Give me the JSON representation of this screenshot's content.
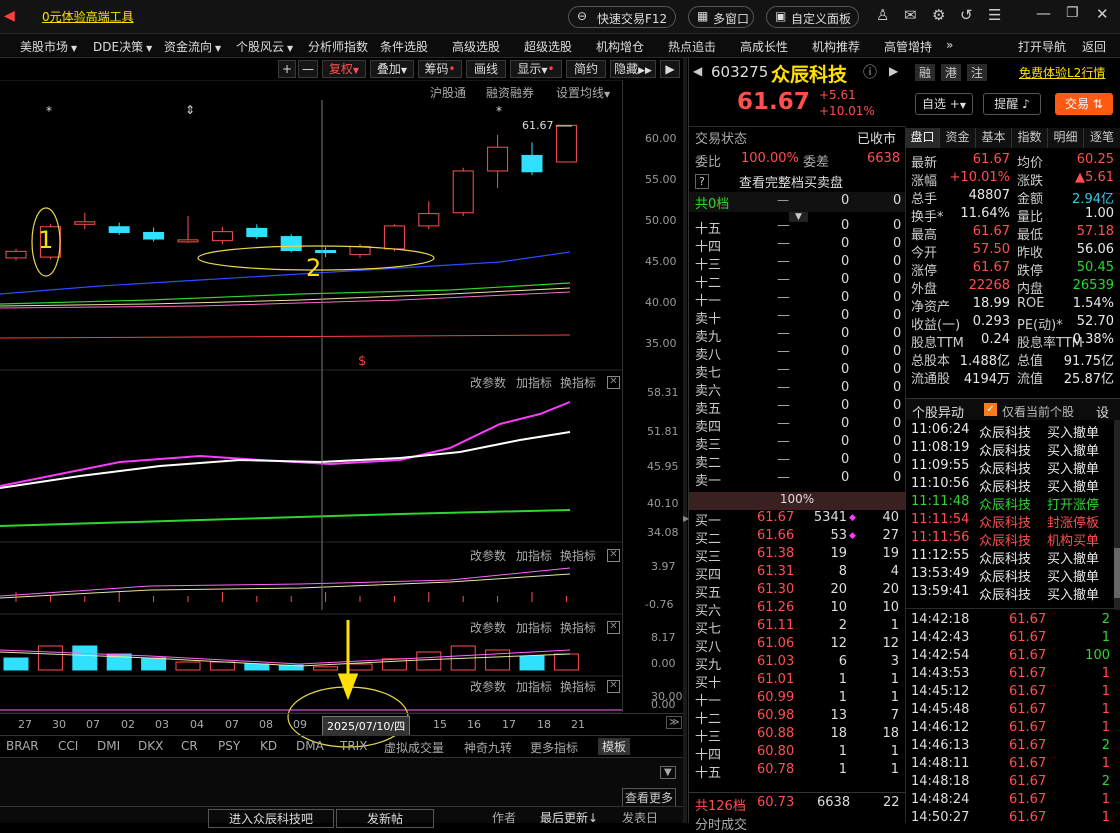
{
  "topbar": {
    "promo": "0元体验高端工具",
    "quick_trade": "快速交易F12",
    "multi_window": "多窗口",
    "custom_panel": "自定义面板"
  },
  "menu": [
    "美股市场",
    "DDE决策",
    "资金流向",
    "个股风云",
    "分析师指数",
    "条件选股",
    "高级选股",
    "超级选股",
    "机构增仓",
    "热点追击",
    "高成长性",
    "机构推荐",
    "高管增持"
  ],
  "menu_more": "»",
  "menu_right": {
    "open_nav": "打开导航",
    "back": "返回"
  },
  "chart_toolbar": {
    "plus": "+",
    "minus": "—",
    "fuquan": "复权",
    "overlay": "叠加",
    "chouma": "筹码",
    "draw": "画线",
    "display": "显示",
    "simple": "简约",
    "hide": "隐藏"
  },
  "chart_subbar": {
    "hgt": "沪股通",
    "rzrq": "融资融券",
    "set_ma": "设置均线"
  },
  "price_axis": [
    "60.00",
    "55.00",
    "50.00",
    "45.00",
    "40.00",
    "35.00"
  ],
  "last_price_label": "61.67",
  "annotations": {
    "a1": "1",
    "a2": "2",
    "s_mark": "$",
    "star": "*"
  },
  "panel_btns": {
    "params": "改参数",
    "add_ind": "加指标",
    "switch_ind": "换指标",
    "close": "✕"
  },
  "ind1_axis": [
    "58.31",
    "51.81",
    "45.95",
    "40.10",
    "34.08"
  ],
  "ind2_axis": [
    "3.97",
    "-0.76"
  ],
  "ind3_axis": [
    "8.17",
    "0.00"
  ],
  "ind4_axis": [
    "30.00",
    "0.00"
  ],
  "dates": [
    "27",
    "30",
    "07",
    "02",
    "03",
    "04",
    "07",
    "08",
    "09",
    "2025/07/10/四",
    "15",
    "16",
    "17",
    "18",
    "21"
  ],
  "ind_tabs": [
    "BRAR",
    "CCI",
    "DMI",
    "DKX",
    "CR",
    "PSY",
    "KD",
    "DMA",
    "TRIX",
    "虚拟成交量",
    "神奇九转",
    "更多指标",
    "模板"
  ],
  "bottom": {
    "see_more": "查看更多",
    "forum": "进入众辰科技吧",
    "post": "发新帖",
    "author": "作者",
    "last_update": "最后更新",
    "post_time": "发表日"
  },
  "stock": {
    "code": "603275",
    "name": "众辰科技",
    "price": "61.67",
    "change": "+5.61",
    "change_pct": "+10.01%",
    "tags": [
      "融",
      "港",
      "注"
    ],
    "l2": "免费体验L2行情",
    "zixuan": "自选",
    "remind": "提醒",
    "trade": "交易"
  },
  "status": {
    "label": "交易状态",
    "value": "已收市",
    "weibi_label": "委比",
    "weibi": "100.00%",
    "weicha_label": "委差",
    "weicha": "6638",
    "help": "?",
    "full_book": "查看完整档买卖盘",
    "total_label": "共0档",
    "dash": "—",
    "zero": "0"
  },
  "sell_rows": [
    {
      "l": "十五"
    },
    {
      "l": "十四"
    },
    {
      "l": "十三"
    },
    {
      "l": "十二"
    },
    {
      "l": "十一"
    },
    {
      "l": "卖十"
    },
    {
      "l": "卖九"
    },
    {
      "l": "卖八"
    },
    {
      "l": "卖七"
    },
    {
      "l": "卖六"
    },
    {
      "l": "卖五"
    },
    {
      "l": "卖四"
    },
    {
      "l": "卖三"
    },
    {
      "l": "卖二"
    },
    {
      "l": "卖一"
    }
  ],
  "mid_pct": "100%",
  "buy_rows": [
    {
      "l": "买一",
      "p": "61.67",
      "v": "5341",
      "d": "◆",
      "n": "40"
    },
    {
      "l": "买二",
      "p": "61.66",
      "v": "53",
      "d": "◆",
      "n": "27"
    },
    {
      "l": "买三",
      "p": "61.38",
      "v": "19",
      "d": "",
      "n": "19"
    },
    {
      "l": "买四",
      "p": "61.31",
      "v": "8",
      "d": "",
      "n": "4"
    },
    {
      "l": "买五",
      "p": "61.30",
      "v": "20",
      "d": "",
      "n": "20"
    },
    {
      "l": "买六",
      "p": "61.26",
      "v": "10",
      "d": "",
      "n": "10"
    },
    {
      "l": "买七",
      "p": "61.11",
      "v": "2",
      "d": "",
      "n": "1"
    },
    {
      "l": "买八",
      "p": "61.06",
      "v": "12",
      "d": "",
      "n": "12"
    },
    {
      "l": "买九",
      "p": "61.03",
      "v": "6",
      "d": "",
      "n": "3"
    },
    {
      "l": "买十",
      "p": "61.01",
      "v": "1",
      "d": "",
      "n": "1"
    },
    {
      "l": "十一",
      "p": "60.99",
      "v": "1",
      "d": "",
      "n": "1"
    },
    {
      "l": "十二",
      "p": "60.98",
      "v": "13",
      "d": "",
      "n": "7"
    },
    {
      "l": "十三",
      "p": "60.88",
      "v": "18",
      "d": "",
      "n": "18"
    },
    {
      "l": "十四",
      "p": "60.80",
      "v": "1",
      "d": "",
      "n": "1"
    },
    {
      "l": "十五",
      "p": "60.78",
      "v": "1",
      "d": "",
      "n": "1"
    }
  ],
  "buy_total": {
    "l": "共126档",
    "p": "60.73",
    "v": "6638",
    "n": "22"
  },
  "time_trade": "分时成交",
  "quote_tabs": [
    "盘口",
    "资金",
    "基本",
    "指数",
    "明细",
    "逐笔"
  ],
  "quote": [
    {
      "k1": "最新",
      "v1": "61.67",
      "c1": "red",
      "k2": "均价",
      "v2": "60.25",
      "c2": "red"
    },
    {
      "k1": "涨幅",
      "v1": "+10.01%",
      "c1": "red",
      "k2": "涨跌",
      "v2": "▲5.61",
      "c2": "red"
    },
    {
      "k1": "总手",
      "v1": "48807",
      "c1": "white",
      "k2": "金额",
      "v2": "2.94亿",
      "c2": "cyan"
    },
    {
      "k1": "换手*",
      "v1": "11.64%",
      "c1": "white",
      "k2": "量比",
      "v2": "1.00",
      "c2": "white"
    },
    {
      "k1": "最高",
      "v1": "61.67",
      "c1": "red",
      "k2": "最低",
      "v2": "57.18",
      "c2": "red"
    },
    {
      "k1": "今开",
      "v1": "57.50",
      "c1": "red",
      "k2": "昨收",
      "v2": "56.06",
      "c2": "white"
    },
    {
      "k1": "涨停",
      "v1": "61.67",
      "c1": "red",
      "k2": "跌停",
      "v2": "50.45",
      "c2": "green"
    },
    {
      "k1": "外盘",
      "v1": "22268",
      "c1": "red",
      "k2": "内盘",
      "v2": "26539",
      "c2": "green"
    },
    {
      "k1": "净资产",
      "v1": "18.99",
      "c1": "white",
      "k2": "ROE",
      "v2": "1.54%",
      "c2": "white"
    },
    {
      "k1": "收益(一)",
      "v1": "0.293",
      "c1": "white",
      "k2": "PE(动)*",
      "v2": "52.70",
      "c2": "white"
    },
    {
      "k1": "股息TTM",
      "v1": "0.24",
      "c1": "white",
      "k2": "股息率TTM",
      "v2": "0.38%",
      "c2": "white"
    },
    {
      "k1": "总股本",
      "v1": "1.488亿",
      "c1": "white",
      "k2": "总值",
      "v2": "91.75亿",
      "c2": "white"
    },
    {
      "k1": "流通股",
      "v1": "4194万",
      "c1": "white",
      "k2": "流值",
      "v2": "25.87亿",
      "c2": "white"
    }
  ],
  "anomaly": {
    "title": "个股异动",
    "only_current": "仅看当前个股",
    "settings": "设",
    "rows": [
      {
        "t": "11:06:24",
        "n": "众辰科技",
        "a": "买入撤单",
        "c": "white"
      },
      {
        "t": "11:08:19",
        "n": "众辰科技",
        "a": "买入撤单",
        "c": "white"
      },
      {
        "t": "11:09:55",
        "n": "众辰科技",
        "a": "买入撤单",
        "c": "white"
      },
      {
        "t": "11:10:56",
        "n": "众辰科技",
        "a": "买入撤单",
        "c": "white"
      },
      {
        "t": "11:11:48",
        "n": "众辰科技",
        "a": "打开涨停",
        "c": "green"
      },
      {
        "t": "11:11:54",
        "n": "众辰科技",
        "a": "封涨停板",
        "c": "red"
      },
      {
        "t": "11:11:56",
        "n": "众辰科技",
        "a": "机构买单",
        "c": "red"
      },
      {
        "t": "11:12:55",
        "n": "众辰科技",
        "a": "买入撤单",
        "c": "white"
      },
      {
        "t": "13:53:49",
        "n": "众辰科技",
        "a": "买入撤单",
        "c": "white"
      },
      {
        "t": "13:59:41",
        "n": "众辰科技",
        "a": "买入撤单",
        "c": "white"
      }
    ]
  },
  "ticks": [
    {
      "t": "14:42:18",
      "p": "61.67",
      "v": "2",
      "c": "green"
    },
    {
      "t": "14:42:43",
      "p": "61.67",
      "v": "1",
      "c": "green"
    },
    {
      "t": "14:42:54",
      "p": "61.67",
      "v": "100",
      "c": "green"
    },
    {
      "t": "14:43:53",
      "p": "61.67",
      "v": "1",
      "c": "red"
    },
    {
      "t": "14:45:12",
      "p": "61.67",
      "v": "1",
      "c": "red"
    },
    {
      "t": "14:45:48",
      "p": "61.67",
      "v": "1",
      "c": "red"
    },
    {
      "t": "14:46:12",
      "p": "61.67",
      "v": "1",
      "c": "red"
    },
    {
      "t": "14:46:13",
      "p": "61.67",
      "v": "2",
      "c": "green"
    },
    {
      "t": "14:48:11",
      "p": "61.67",
      "v": "1",
      "c": "red"
    },
    {
      "t": "14:48:18",
      "p": "61.67",
      "v": "2",
      "c": "green"
    },
    {
      "t": "14:48:24",
      "p": "61.67",
      "v": "1",
      "c": "red"
    },
    {
      "t": "14:50:27",
      "p": "61.67",
      "v": "1",
      "c": "red"
    }
  ],
  "candles": [
    {
      "o": 45.5,
      "c": 46.3,
      "h": 46.6,
      "l": 45.2
    },
    {
      "o": 45.6,
      "c": 49.3,
      "h": 49.6,
      "l": 45.3
    },
    {
      "o": 49.6,
      "c": 49.9,
      "h": 51.0,
      "l": 49.0
    },
    {
      "o": 49.3,
      "c": 48.6,
      "h": 49.8,
      "l": 48.3
    },
    {
      "o": 48.6,
      "c": 47.8,
      "h": 49.2,
      "l": 47.5
    },
    {
      "o": 47.5,
      "c": 47.7,
      "h": 50.6,
      "l": 47.3
    },
    {
      "o": 47.6,
      "c": 48.7,
      "h": 49.3,
      "l": 47.2
    },
    {
      "o": 49.1,
      "c": 48.1,
      "h": 49.6,
      "l": 47.8
    },
    {
      "o": 48.1,
      "c": 46.4,
      "h": 48.4,
      "l": 46.2
    },
    {
      "o": 46.4,
      "c": 46.2,
      "h": 46.8,
      "l": 45.6
    },
    {
      "o": 45.9,
      "c": 46.9,
      "h": 47.2,
      "l": 45.5
    },
    {
      "o": 46.6,
      "c": 49.4,
      "h": 49.6,
      "l": 46.3
    },
    {
      "o": 49.4,
      "c": 50.9,
      "h": 52.4,
      "l": 49.0
    },
    {
      "o": 51.0,
      "c": 56.1,
      "h": 56.5,
      "l": 50.6
    },
    {
      "o": 56.1,
      "c": 59.0,
      "h": 60.5,
      "l": 54.0
    },
    {
      "o": 58.0,
      "c": 56.0,
      "h": 59.6,
      "l": 55.6
    },
    {
      "o": 57.2,
      "c": 61.67,
      "h": 61.67,
      "l": 57.2
    }
  ],
  "vol": [
    {
      "v": 3,
      "r": 0
    },
    {
      "v": 6,
      "r": 1
    },
    {
      "v": 6,
      "r": 0
    },
    {
      "v": 4,
      "r": 0
    },
    {
      "v": 3,
      "r": 0
    },
    {
      "v": 2,
      "r": 1
    },
    {
      "v": 2,
      "r": 1
    },
    {
      "v": 1.5,
      "r": 0
    },
    {
      "v": 1.2,
      "r": 0
    },
    {
      "v": 0.8,
      "r": 1
    },
    {
      "v": 1.5,
      "r": 1
    },
    {
      "v": 2.8,
      "r": 1
    },
    {
      "v": 4.5,
      "r": 1
    },
    {
      "v": 6,
      "r": 1
    },
    {
      "v": 5,
      "r": 1
    },
    {
      "v": 3.5,
      "r": 0
    },
    {
      "v": 4,
      "r": 1
    }
  ]
}
